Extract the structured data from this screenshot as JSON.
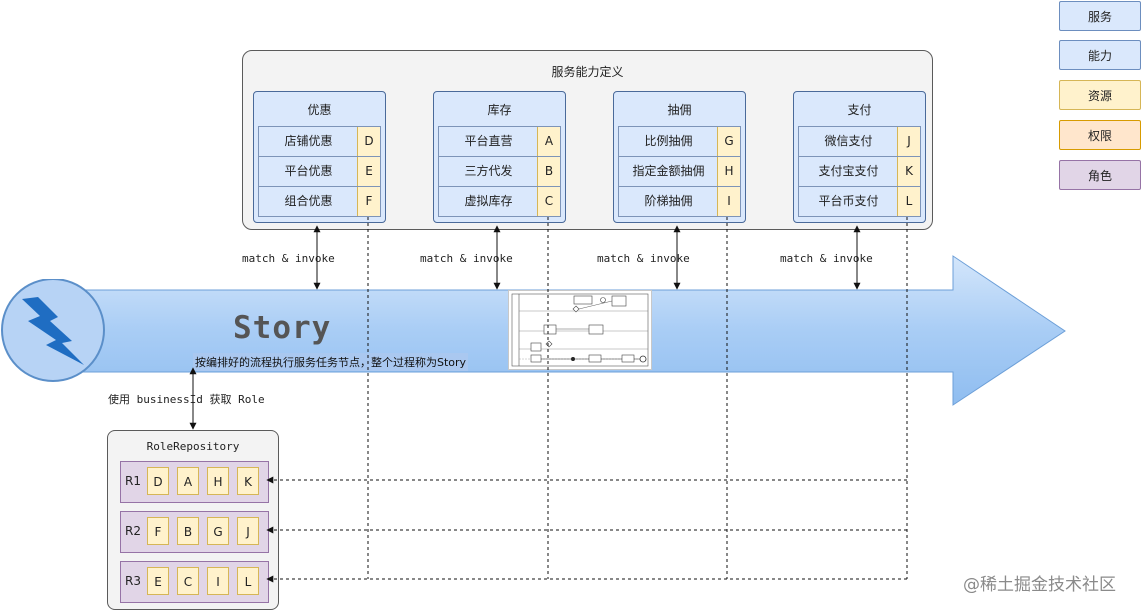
{
  "legend": [
    {
      "label": "服务",
      "color": "#dae8fc",
      "border": "#6c8ebf"
    },
    {
      "label": "能力",
      "color": "#dae8fc",
      "border": "#6c8ebf"
    },
    {
      "label": "资源",
      "color": "#fff2cc",
      "border": "#d6b656"
    },
    {
      "label": "权限",
      "color": "#ffe6cc",
      "border": "#d79b00"
    },
    {
      "label": "角色",
      "color": "#e1d5e7",
      "border": "#9673a6"
    }
  ],
  "service_container": {
    "title": "服务能力定义",
    "services": [
      {
        "name": "优惠",
        "capabilities": [
          {
            "label": "店铺优惠",
            "code": "D"
          },
          {
            "label": "平台优惠",
            "code": "E"
          },
          {
            "label": "组合优惠",
            "code": "F"
          }
        ]
      },
      {
        "name": "库存",
        "capabilities": [
          {
            "label": "平台直营",
            "code": "A"
          },
          {
            "label": "三方代发",
            "code": "B"
          },
          {
            "label": "虚拟库存",
            "code": "C"
          }
        ]
      },
      {
        "name": "抽佣",
        "capabilities": [
          {
            "label": "比例抽佣",
            "code": "G"
          },
          {
            "label": "指定金额抽佣",
            "code": "H"
          },
          {
            "label": "阶梯抽佣",
            "code": "I"
          }
        ]
      },
      {
        "name": "支付",
        "capabilities": [
          {
            "label": "微信支付",
            "code": "J"
          },
          {
            "label": "支付宝支付",
            "code": "K"
          },
          {
            "label": "平台币支付",
            "code": "L"
          }
        ]
      }
    ]
  },
  "match_labels": [
    "match & invoke",
    "match & invoke",
    "match & invoke",
    "match & invoke"
  ],
  "story": {
    "title": "Story",
    "description": "按编排好的流程执行服务任务节点，整个过程称为Story",
    "icon": "lightning-bolt-icon",
    "arrow_color": "#a9cdf5"
  },
  "lookup_label": "使用 businessId 获取 Role",
  "role_repository": {
    "title": "RoleRepository",
    "roles": [
      {
        "id": "R1",
        "resources": [
          "D",
          "A",
          "H",
          "K"
        ]
      },
      {
        "id": "R2",
        "resources": [
          "F",
          "B",
          "G",
          "J"
        ]
      },
      {
        "id": "R3",
        "resources": [
          "E",
          "C",
          "I",
          "L"
        ]
      }
    ]
  },
  "watermark": "@稀土掘金技术社区"
}
